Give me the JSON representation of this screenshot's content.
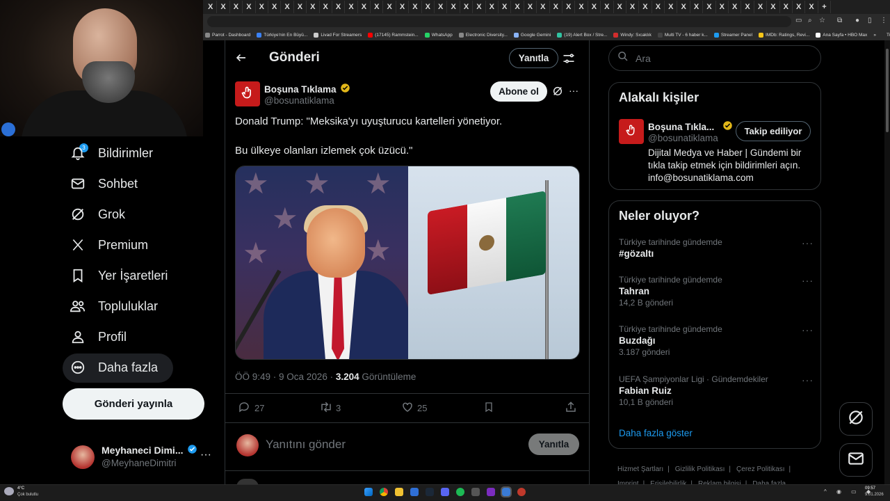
{
  "browser": {
    "tab_glyph": "X",
    "new_tab": "+",
    "bookmarks": [
      {
        "label": "Parrot - Dashboard",
        "color": "#888888"
      },
      {
        "label": "Türkiye'nin En Büyü...",
        "color": "#3b82f6"
      },
      {
        "label": "Livad For Streamers",
        "color": "#cccccc"
      },
      {
        "label": "(17145) Rammstein...",
        "color": "#ff0000"
      },
      {
        "label": "WhatsApp",
        "color": "#25d366"
      },
      {
        "label": "Electronic Diversity...",
        "color": "#888888"
      },
      {
        "label": "Google Gemini",
        "color": "#8ab4f8"
      },
      {
        "label": "(19) Alert Box / Stre...",
        "color": "#31c3a2"
      },
      {
        "label": "Windy: Sıcaklık",
        "color": "#d22d2d"
      },
      {
        "label": "Multi TV - 6 haber k...",
        "color": "#444444"
      },
      {
        "label": "Streamer Panel",
        "color": "#1d9bf0"
      },
      {
        "label": "IMDb: Ratings, Revi...",
        "color": "#f5c518"
      },
      {
        "label": "Ana Sayfa • HBO Max",
        "color": "#ffffff"
      }
    ],
    "bookmarks_more": "»",
    "all_bookmarks": "Tüm Yer İşaretleri"
  },
  "nav": {
    "notifications_badge": "3",
    "items": [
      {
        "label": "Bildirimler",
        "icon": "bell-icon"
      },
      {
        "label": "Sohbet",
        "icon": "mail-icon"
      },
      {
        "label": "Grok",
        "icon": "grok-icon"
      },
      {
        "label": "Premium",
        "icon": "x-logo-icon"
      },
      {
        "label": "Yer İşaretleri",
        "icon": "bookmark-icon"
      },
      {
        "label": "Topluluklar",
        "icon": "communities-icon"
      },
      {
        "label": "Profil",
        "icon": "profile-icon"
      },
      {
        "label": "Daha fazla",
        "icon": "more-circle-icon"
      }
    ],
    "post_button": "Gönderi yayınla",
    "account": {
      "name": "Meyhaneci Dimi...",
      "handle": "@MeyhaneDimitri",
      "more": "···"
    }
  },
  "header": {
    "title": "Gönderi",
    "reply_button": "Yanıtla"
  },
  "tweet": {
    "author_name": "Boşuna Tıklama",
    "author_handle": "@bosunatiklama",
    "follow_button": "Abone ol",
    "text_line1": "Donald Trump: \"Meksika'yı uyuşturucu kartelleri yönetiyor.",
    "text_line2": "Bu ülkeye olanları izlemek çok üzücü.\"",
    "meta_time": "ÖÖ 9:49 · 9 Oca 2026 · ",
    "views_count": "3.204",
    "views_label": " Görüntüleme",
    "replies": "27",
    "retweets": "3",
    "likes": "25",
    "reply_placeholder": "Yanıtını gönder",
    "reply_submit": "Yanıtla"
  },
  "search": {
    "placeholder": "Ara"
  },
  "related": {
    "title": "Alakalı kişiler",
    "name": "Boşuna Tıkla...",
    "handle": "@bosunatiklama",
    "follow_state": "Takip ediliyor",
    "bio": "Dijital Medya ve Haber | Gündemi bir tıkla takip etmek için bildirimleri açın. info@bosunatiklama.com"
  },
  "trends": {
    "title": "Neler oluyor?",
    "items": [
      {
        "context": "Türkiye tarihinde gündemde",
        "name": "#gözaltı",
        "count": ""
      },
      {
        "context": "Türkiye tarihinde gündemde",
        "name": "Tahran",
        "count": "14,2 B gönderi"
      },
      {
        "context": "Türkiye tarihinde gündemde",
        "name": "Buzdağı",
        "count": "3.187 gönderi"
      },
      {
        "context": "UEFA Şampiyonlar Ligi · Gündemdekiler",
        "name": "Fabian Ruiz",
        "count": "10,1 B gönderi"
      }
    ],
    "more": "···",
    "show_more": "Daha fazla göster"
  },
  "footer": {
    "links": [
      "Hizmet Şartları",
      "Gizlilik Politikası",
      "Çerez Politikası",
      "Imprint",
      "Erişilebilirlik",
      "Reklam bilgisi",
      "Daha fazla ..."
    ]
  },
  "taskbar": {
    "weather_temp": "4°C",
    "weather_desc": "Çok bulutlu",
    "time": "09:57",
    "date": "9.01.2026"
  },
  "colors": {
    "accent": "#1d9bf0",
    "background": "#000000",
    "border": "#2f3336",
    "muted": "#71767b"
  }
}
